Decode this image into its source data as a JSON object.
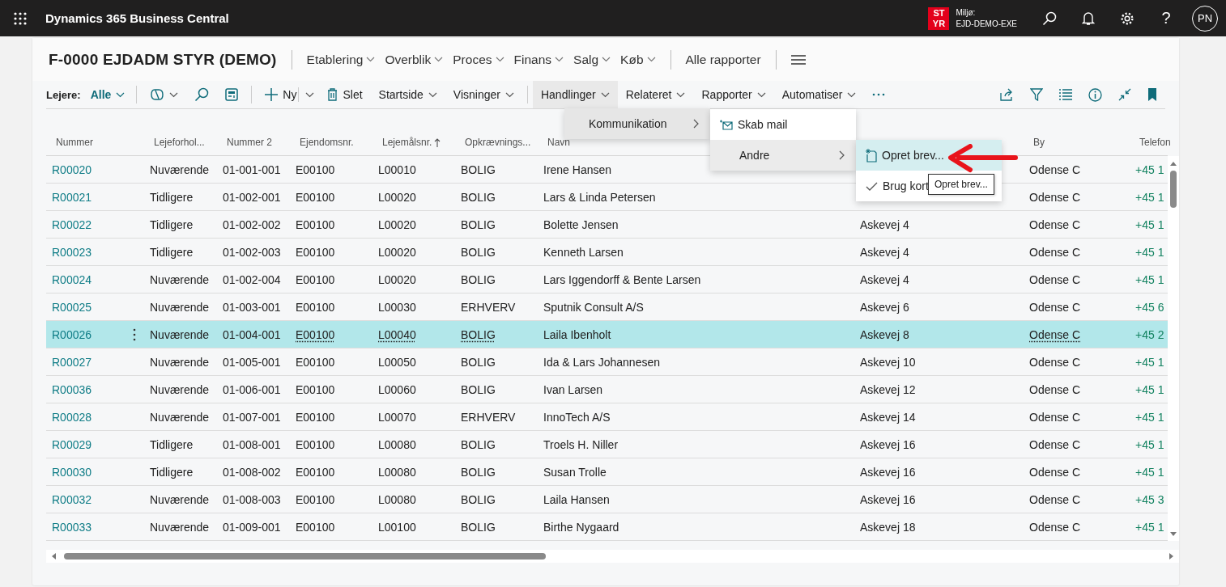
{
  "top_bar": {
    "app_title": "Dynamics 365 Business Central",
    "environment_badge": "ST YR",
    "environment_label": "Miljø:",
    "environment_name": "EJD-DEMO-EXE",
    "help": "?",
    "avatar_initials": "PN"
  },
  "page": {
    "title": "F-0000 EJDADM STYR (DEMO)",
    "nav": [
      "Etablering",
      "Overblik",
      "Proces",
      "Finans",
      "Salg",
      "Køb"
    ],
    "reports_link": "Alle rapporter"
  },
  "action_bar": {
    "filter_label": "Lejere:",
    "filter_value": "Alle",
    "new_label": "Ny",
    "delete_label": "Slet",
    "view_menus": [
      {
        "label": "Startside",
        "selected": false
      },
      {
        "label": "Visninger",
        "selected": false
      }
    ],
    "action_menus": [
      {
        "label": "Handlinger",
        "selected": true
      },
      {
        "label": "Relateret",
        "selected": false
      },
      {
        "label": "Rapporter",
        "selected": false
      },
      {
        "label": "Automatiser",
        "selected": false
      }
    ]
  },
  "menus": [
    {
      "items": [
        {
          "label": "Kommunikation",
          "kind": "submenu",
          "selected": true
        }
      ]
    },
    {
      "items": [
        {
          "label": "Skab mail",
          "kind": "mail",
          "selected": false
        },
        {
          "label": "Andre",
          "kind": "submenu",
          "selected": true
        }
      ]
    },
    {
      "items": [
        {
          "label": "Opret brev...",
          "kind": "letter",
          "selected": true
        },
        {
          "label": "Brug kort",
          "kind": "check",
          "selected": false
        }
      ]
    }
  ],
  "tooltip": "Opret brev...",
  "table": {
    "columns": [
      {
        "label": "Nummer",
        "kind": "link",
        "sorted": false
      },
      {
        "label": "Lejeforhol...",
        "kind": "text",
        "sorted": false
      },
      {
        "label": "Nummer 2",
        "kind": "text",
        "sorted": false
      },
      {
        "label": "Ejendomsnr.",
        "kind": "text",
        "sorted": false
      },
      {
        "label": "Lejemålsnr.",
        "kind": "text",
        "sorted": true
      },
      {
        "label": "Opkrævnings...",
        "kind": "text",
        "sorted": false
      },
      {
        "label": "Navn",
        "kind": "text",
        "sorted": false
      },
      {
        "kind": "text"
      },
      {
        "label": "By",
        "kind": "text",
        "sorted": false
      },
      {
        "label": "Telefon",
        "kind": "phone",
        "sorted": false
      }
    ],
    "rows": [
      {
        "selected": false,
        "cells": [
          "R00020",
          "Nuværende",
          "01-001-001",
          "E00100",
          "L00010",
          "BOLIG",
          "Irene Hansen",
          null,
          "Odense C",
          "+45 1"
        ]
      },
      {
        "selected": false,
        "cells": [
          "R00021",
          "Tidligere",
          "01-002-001",
          "E00100",
          "L00020",
          "BOLIG",
          "Lars & Linda Petersen",
          null,
          "Odense C",
          "+45 1"
        ]
      },
      {
        "selected": false,
        "cells": [
          "R00022",
          "Tidligere",
          "01-002-002",
          "E00100",
          "L00020",
          "BOLIG",
          "Bolette Jensen",
          "Askevej 4",
          "Odense C",
          "+45 1"
        ]
      },
      {
        "selected": false,
        "cells": [
          "R00023",
          "Tidligere",
          "01-002-003",
          "E00100",
          "L00020",
          "BOLIG",
          "Kenneth Larsen",
          "Askevej 4",
          "Odense C",
          "+45 1"
        ]
      },
      {
        "selected": false,
        "cells": [
          "R00024",
          "Nuværende",
          "01-002-004",
          "E00100",
          "L00020",
          "BOLIG",
          "Lars Iggendorff & Bente Larsen",
          "Askevej 4",
          "Odense C",
          "+45 1"
        ]
      },
      {
        "selected": false,
        "cells": [
          "R00025",
          "Nuværende",
          "01-003-001",
          "E00100",
          "L00030",
          "ERHVERV",
          "Sputnik Consult A/S",
          "Askevej 6",
          "Odense C",
          "+45 6"
        ]
      },
      {
        "selected": true,
        "cells": [
          "R00026",
          "Nuværende",
          "01-004-001",
          "E00100",
          "L00040",
          "BOLIG",
          "Laila Ibenholt",
          "Askevej 8",
          "Odense C",
          "+45 2"
        ]
      },
      {
        "selected": false,
        "cells": [
          "R00027",
          "Nuværende",
          "01-005-001",
          "E00100",
          "L00050",
          "BOLIG",
          "Ida & Lars Johannesen",
          "Askevej 10",
          "Odense C",
          "+45 1"
        ]
      },
      {
        "selected": false,
        "cells": [
          "R00036",
          "Nuværende",
          "01-006-001",
          "E00100",
          "L00060",
          "BOLIG",
          "Ivan Larsen",
          "Askevej 12",
          "Odense C",
          "+45 1"
        ]
      },
      {
        "selected": false,
        "cells": [
          "R00028",
          "Nuværende",
          "01-007-001",
          "E00100",
          "L00070",
          "ERHVERV",
          "InnoTech A/S",
          "Askevej 14",
          "Odense C",
          "+45 1"
        ]
      },
      {
        "selected": false,
        "cells": [
          "R00029",
          "Tidligere",
          "01-008-001",
          "E00100",
          "L00080",
          "BOLIG",
          "Troels H. Niller",
          "Askevej 16",
          "Odense C",
          "+45 1"
        ]
      },
      {
        "selected": false,
        "cells": [
          "R00030",
          "Tidligere",
          "01-008-002",
          "E00100",
          "L00080",
          "BOLIG",
          "Susan Trolle",
          "Askevej 16",
          "Odense C",
          "+45 1"
        ]
      },
      {
        "selected": false,
        "cells": [
          "R00032",
          "Nuværende",
          "01-008-003",
          "E00100",
          "L00080",
          "BOLIG",
          "Laila Hansen",
          "Askevej 16",
          "Odense C",
          "+45 3"
        ]
      },
      {
        "selected": false,
        "cells": [
          "R00033",
          "Nuværende",
          "01-009-001",
          "E00100",
          "L00100",
          "BOLIG",
          "Birthe Nygaard",
          "Askevej 18",
          "Odense C",
          "+45 1"
        ]
      }
    ]
  }
}
